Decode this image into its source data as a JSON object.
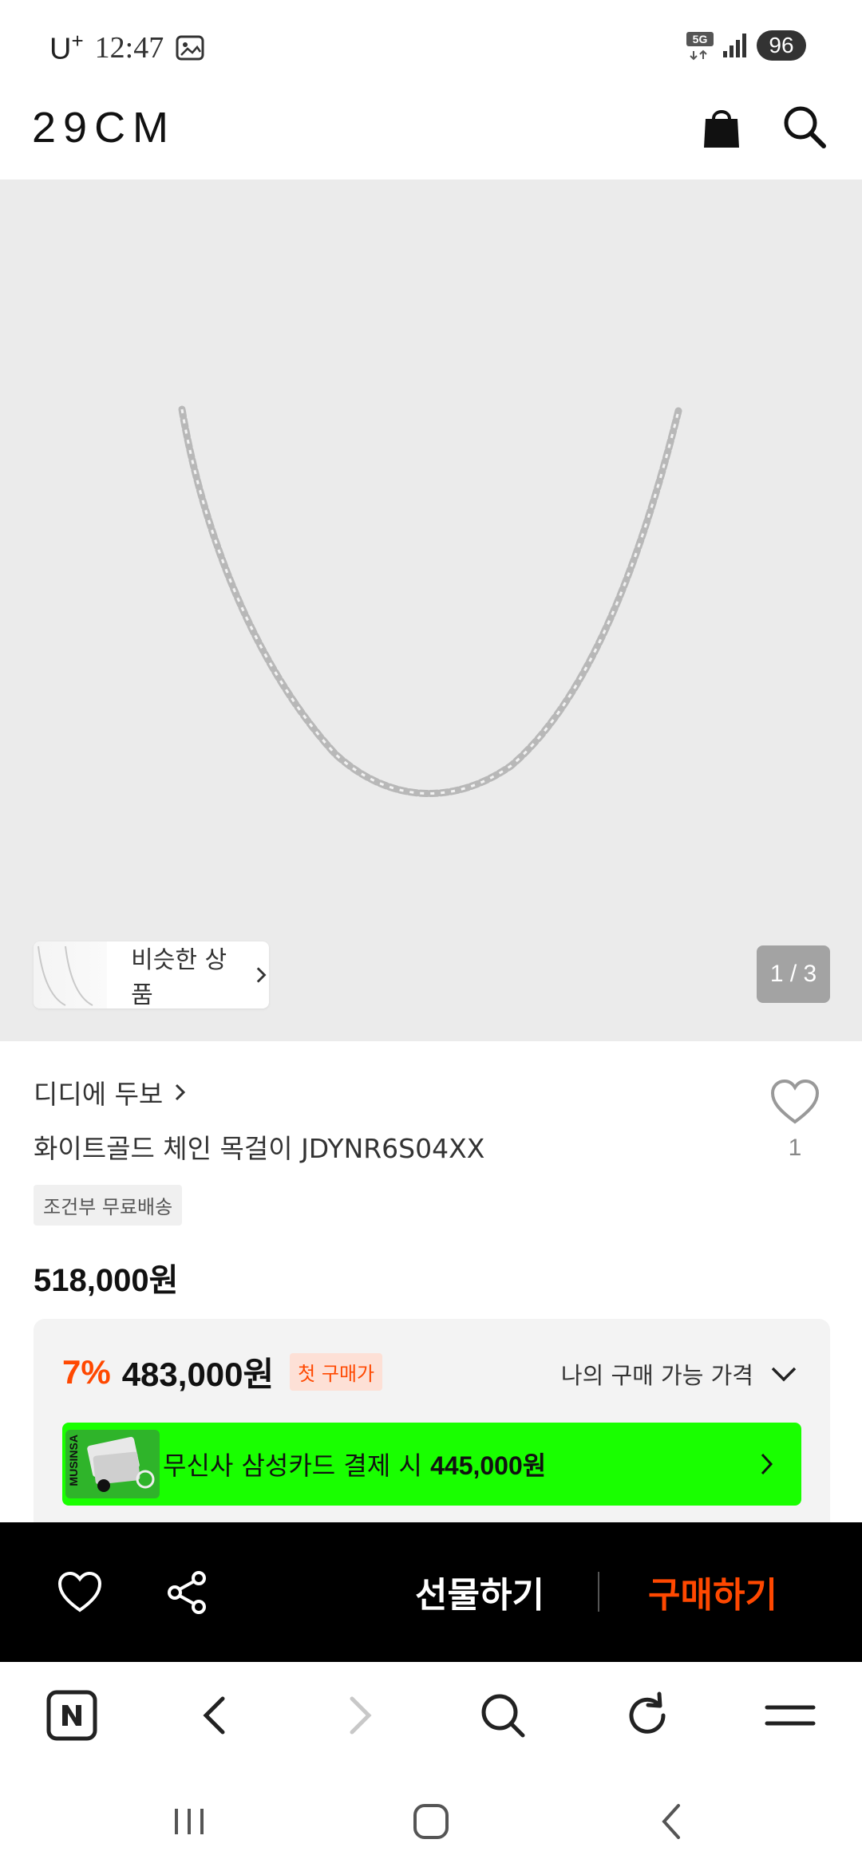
{
  "status_bar": {
    "carrier": "U",
    "carrier_plus": "+",
    "time": "12:47",
    "network": "5G",
    "battery": "96"
  },
  "header": {
    "logo": "29CM"
  },
  "hero": {
    "similar_label": "비슷한 상품",
    "pager": "1 / 3"
  },
  "product": {
    "brand": "디디에 두보",
    "name": "화이트골드 체인 목걸이 JDYNR6S04XX",
    "like_count": "1",
    "shipping_tag": "조건부 무료배송",
    "price": "518,000원"
  },
  "discount": {
    "rate": "7%",
    "price": "483,000원",
    "badge": "첫 구매가",
    "my_price_label": "나의 구매 가능 가격",
    "card_logo": "MUSINSA",
    "card_text": "무신사 삼성카드 결제 시 ",
    "card_price": "445,000원"
  },
  "action_bar": {
    "gift_label": "선물하기",
    "buy_label": "구매하기"
  },
  "colors": {
    "accent": "#ff4800",
    "banner_green": "#19ff00",
    "hero_bg": "#ebebeb"
  },
  "icons": {
    "header": [
      "bag-icon",
      "search-icon"
    ],
    "action_bar": [
      "heart-icon",
      "share-icon"
    ],
    "browser": [
      "naver-n-icon",
      "back-icon",
      "forward-icon",
      "search-icon",
      "refresh-icon",
      "menu-icon"
    ],
    "system": [
      "recents-icon",
      "home-icon",
      "back-icon"
    ]
  }
}
